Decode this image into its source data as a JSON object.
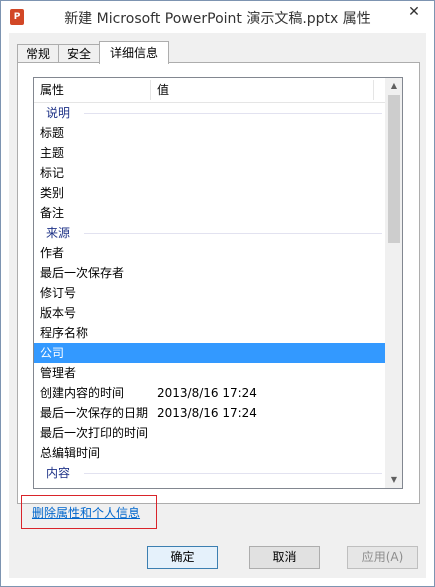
{
  "window": {
    "title": "新建 Microsoft PowerPoint 演示文稿.pptx 属性",
    "app_icon_letter": "P",
    "close_label": "✕"
  },
  "tabs": [
    {
      "label": "常规"
    },
    {
      "label": "安全"
    },
    {
      "label": "详细信息"
    }
  ],
  "list": {
    "col_property": "属性",
    "col_value": "值",
    "groups": {
      "description": "说明",
      "origin": "来源",
      "content": "内容"
    },
    "description_rows": [
      {
        "k": "标题",
        "v": ""
      },
      {
        "k": "主题",
        "v": ""
      },
      {
        "k": "标记",
        "v": ""
      },
      {
        "k": "类别",
        "v": ""
      },
      {
        "k": "备注",
        "v": ""
      }
    ],
    "origin_rows": [
      {
        "k": "作者",
        "v": ""
      },
      {
        "k": "最后一次保存者",
        "v": ""
      },
      {
        "k": "修订号",
        "v": ""
      },
      {
        "k": "版本号",
        "v": ""
      },
      {
        "k": "程序名称",
        "v": ""
      },
      {
        "k": "公司",
        "v": ""
      },
      {
        "k": "管理者",
        "v": ""
      },
      {
        "k": "创建内容的时间",
        "v": "2013/8/16 17:24"
      },
      {
        "k": "最后一次保存的日期",
        "v": "2013/8/16 17:24"
      },
      {
        "k": "最后一次打印的时间",
        "v": ""
      },
      {
        "k": "总编辑时间",
        "v": ""
      }
    ]
  },
  "remove_link": "删除属性和个人信息",
  "buttons": {
    "ok": "确定",
    "cancel": "取消",
    "apply": "应用(A)"
  }
}
